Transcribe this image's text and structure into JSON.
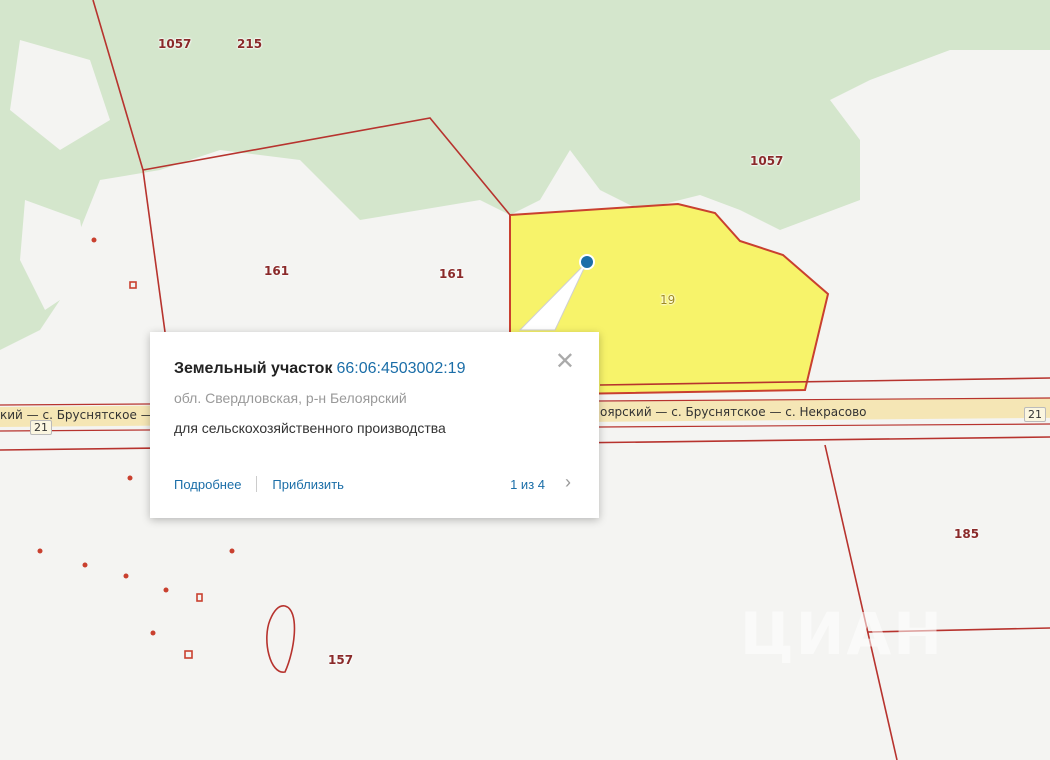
{
  "parcel_labels": [
    "1057",
    "215",
    "1057",
    "161",
    "161",
    "19",
    "185",
    "157"
  ],
  "road": {
    "left_label": "кий — с. Бруснятское —",
    "right_label": "оярский — с. Бруснятское — с. Некрасово",
    "number": "21"
  },
  "watermark": "ЦИАН",
  "popup": {
    "title": "Земельный участок",
    "cadastral_number": "66:06:4503002:19",
    "region": "обл. Свердловская, р-н Белоярский",
    "usage": "для сельскохозяйственного производства",
    "link_details": "Подробнее",
    "link_zoom": "Приблизить",
    "pagination": "1 из 4"
  },
  "colors": {
    "forest": "#d4e6cc",
    "parcel_fill": "#f7f36a",
    "boundary": "#b7332e",
    "link": "#1b6ea8"
  },
  "icons": [
    "close-icon",
    "chevron-right-icon",
    "location-marker-icon"
  ]
}
